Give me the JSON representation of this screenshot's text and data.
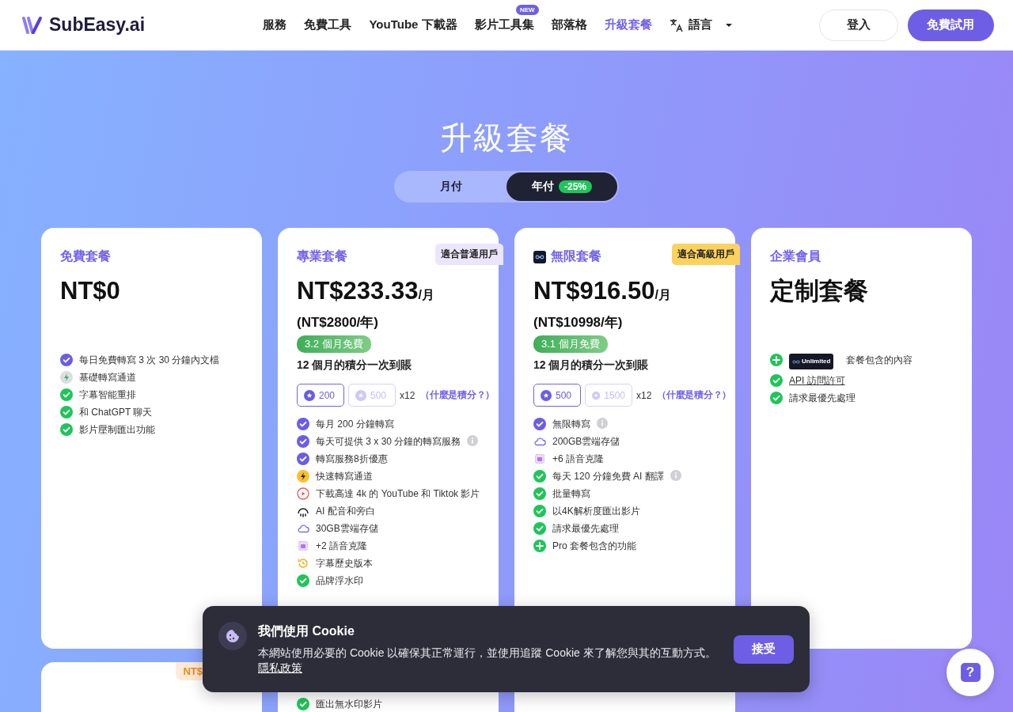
{
  "header": {
    "logo": "SubEasy.ai",
    "nav": [
      {
        "label": "服務",
        "selected": false
      },
      {
        "label": "免費工具",
        "selected": false
      },
      {
        "label": "YouTube 下載器",
        "selected": false
      },
      {
        "label": "影片工具集",
        "selected": false,
        "badge": "NEW"
      },
      {
        "label": "部落格",
        "selected": false
      },
      {
        "label": "升級套餐",
        "selected": true
      },
      {
        "label": "語言",
        "selected": false,
        "kind": "language"
      }
    ],
    "login": "登入",
    "trial": "免費試用"
  },
  "title": "升級套餐",
  "billing": [
    {
      "label": "月付",
      "selected": false
    },
    {
      "label": "年付",
      "selected": true,
      "badge": "-25%"
    }
  ],
  "plans": [
    {
      "name": "免費套餐",
      "price": "NT$0",
      "features": [
        {
          "kind": "check-purple",
          "text": "每日免費轉寫 3 次 30 分鐘內文檔"
        },
        {
          "kind": "bolt-grey",
          "text": "基礎轉寫通道"
        },
        {
          "kind": "check-green",
          "text": "字幕智能重排"
        },
        {
          "kind": "check-green",
          "text": "和 ChatGPT 聊天"
        },
        {
          "kind": "check-green",
          "text": "影片壓制匯出功能"
        }
      ]
    },
    {
      "name": "專業套餐",
      "ribbon": {
        "text": "適合普通用戶",
        "color": "#ece6fd"
      },
      "price": "NT$233.33",
      "unit": "/月",
      "yearly": "(NT$2800/年)",
      "free_badge": "3.2 個月免費",
      "note": "12 個月的積分一次到賬",
      "credits": [
        {
          "label": "200",
          "selected": true
        },
        {
          "label": "500",
          "selected": false
        }
      ],
      "multiplier": "x12",
      "credits_link": "（什麼是積分？）",
      "features": [
        {
          "kind": "check-purple",
          "text": "每月 200 分鐘轉寫"
        },
        {
          "kind": "check-purple",
          "text": "每天可提供 3 x 30 分鐘的轉寫服務",
          "info": true
        },
        {
          "kind": "check-purple",
          "text": "轉寫服務8折優惠"
        },
        {
          "kind": "bolt-yellow",
          "text": "快速轉寫通道"
        },
        {
          "kind": "play",
          "text": "下載高達 4k 的 YouTube 和 Tiktok 影片"
        },
        {
          "kind": "voice",
          "text": "AI 配音和旁白"
        },
        {
          "kind": "cloud",
          "text": "30GB雲端存儲"
        },
        {
          "kind": "clone",
          "text": "+2 語音克隆"
        },
        {
          "kind": "history",
          "text": "字幕歷史版本"
        },
        {
          "kind": "check-green",
          "text": "品牌浮水印"
        }
      ],
      "features_below": [
        {
          "kind": "check-green",
          "text": "匯出無水印影片"
        }
      ]
    },
    {
      "name": "無限套餐",
      "logo": true,
      "ribbon": {
        "text": "適合高級用戶",
        "color": "#fcd25c"
      },
      "price": "NT$916.50",
      "unit": "/月",
      "yearly": "(NT$10998/年)",
      "free_badge": "3.1 個月免費",
      "note": "12 個月的積分一次到賬",
      "credits": [
        {
          "label": "500",
          "selected": true
        },
        {
          "label": "1500",
          "selected": false
        }
      ],
      "multiplier": "x12",
      "credits_link": "（什麼是積分？）",
      "features": [
        {
          "kind": "check-purple",
          "text": "無限轉寫",
          "info": true
        },
        {
          "kind": "cloud",
          "text": "200GB雲端存儲"
        },
        {
          "kind": "clone",
          "text": "+6 語音克隆"
        },
        {
          "kind": "check-green",
          "text": "每天 120 分鐘免費 AI 翻譯",
          "info": true
        },
        {
          "kind": "check-green",
          "text": "批量轉寫"
        },
        {
          "kind": "check-green",
          "text": "以4K解析度匯出影片"
        },
        {
          "kind": "check-green",
          "text": "請求最優先處理"
        },
        {
          "kind": "plus",
          "text": "Pro 套餐包含的功能"
        }
      ]
    },
    {
      "name": "企業會員",
      "price": "定制套餐",
      "features": [
        {
          "kind": "plus",
          "badge": "Unlimited",
          "text": "套餐包含的內容"
        },
        {
          "kind": "check-green",
          "text": "API 訪問許可",
          "link": true
        },
        {
          "kind": "check-green",
          "text": "請求最優先處理"
        }
      ]
    }
  ],
  "second_row_card": {
    "ribbon": "NT$"
  },
  "cookie": {
    "title": "我們使用 Cookie",
    "text": "本網站使用必要的 Cookie 以確保其正常運行，並使用追蹤 Cookie 來了解您與其的互動方式。",
    "link": "隱私政策",
    "accept": "接受"
  },
  "help": "?"
}
